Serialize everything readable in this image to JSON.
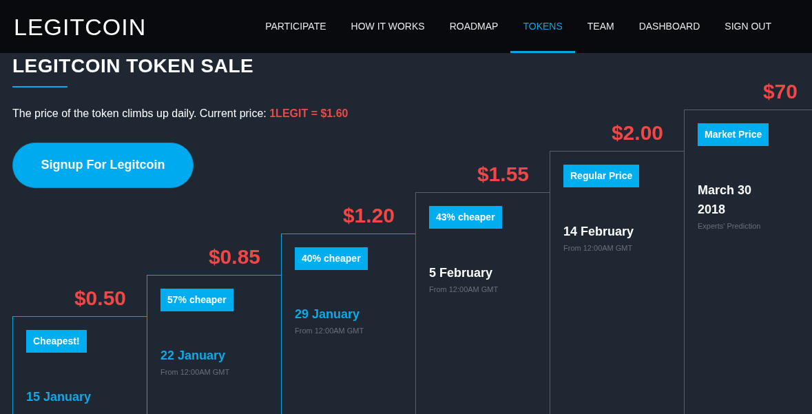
{
  "header": {
    "logo": "LEGITCOIN",
    "nav": [
      {
        "label": "PARTICIPATE",
        "selected": false
      },
      {
        "label": "HOW IT WORKS",
        "selected": false
      },
      {
        "label": "ROADMAP",
        "selected": false
      },
      {
        "label": "TOKENS",
        "selected": true
      },
      {
        "label": "TEAM",
        "selected": false
      },
      {
        "label": "DASHBOARD",
        "selected": false
      },
      {
        "label": "SIGN OUT",
        "selected": false
      }
    ]
  },
  "section": {
    "title": "LEGITCOIN TOKEN SALE",
    "intro": "The price of the token climbs up daily. Current price: **1LEGIT = $1.60**",
    "signup_button": "Signup For Legitcoin"
  },
  "tiers": [
    {
      "price": "$0.50",
      "badge": "Cheapest!",
      "date": "15 January",
      "past": true
    },
    {
      "price": "$0.85",
      "badge": "57% cheaper",
      "date": "22 January",
      "note": "From 12:00AM GMT",
      "past": true
    },
    {
      "price": "$1.20",
      "badge": "40% cheaper",
      "date": "29 January",
      "note": "From 12:00AM GMT",
      "past": true
    },
    {
      "price": "$1.55",
      "badge": "43% cheaper",
      "date": "5 February",
      "note": "From 12:00AM GMT",
      "past": false
    },
    {
      "price": "$2.00",
      "badge": "Regular Price",
      "date": "14 February",
      "note": "From 12:00AM GMT",
      "past": false
    },
    {
      "price": "$70",
      "badge": "Market Price",
      "date": "March 30 2018",
      "note": "Experts' Prediction",
      "past": false
    }
  ]
}
